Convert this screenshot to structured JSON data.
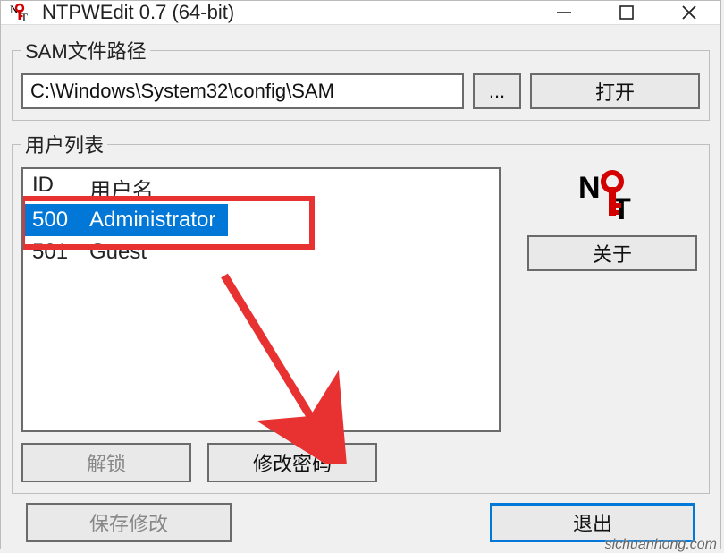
{
  "window": {
    "title": "NTPWEdit 0.7 (64-bit)"
  },
  "path_group": {
    "legend": "SAM文件路径",
    "value": "C:\\Windows\\System32\\config\\SAM",
    "browse_label": "...",
    "open_label": "打开"
  },
  "userlist_group": {
    "legend": "用户列表",
    "header_id": "ID",
    "header_name": "用户名",
    "rows": [
      {
        "id": "500",
        "name": "Administrator",
        "selected": true
      },
      {
        "id": "501",
        "name": "Guest",
        "selected": false
      }
    ],
    "unlock_label": "解锁",
    "changepw_label": "修改密码",
    "about_label": "关于"
  },
  "bottom": {
    "save_label": "保存修改",
    "exit_label": "退出"
  },
  "watermark": "sichuanhong.com"
}
